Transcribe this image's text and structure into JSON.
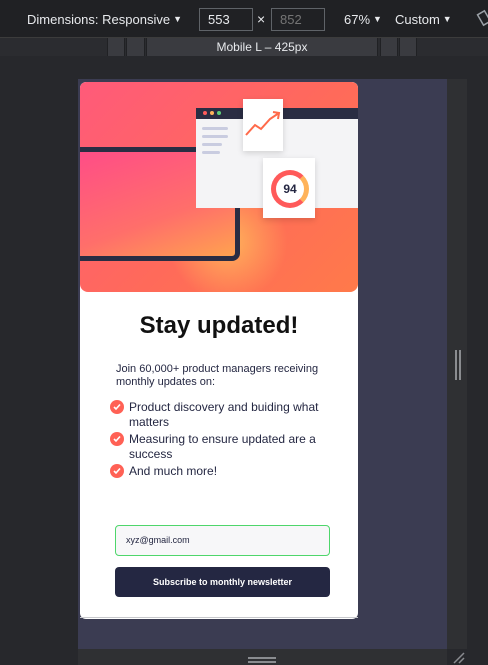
{
  "devtools": {
    "dimensions_label": "Dimensions: Responsive",
    "width_value": "553",
    "height_placeholder": "852",
    "times": "×",
    "zoom": "67%",
    "throttle": "Custom",
    "media_label": "Mobile L – 425px"
  },
  "newsletter": {
    "title": "Stay updated!",
    "intro": "Join 60,000+ product managers receiving monthly updates on:",
    "items": [
      "Product discovery and buiding what matters",
      "Measuring to ensure updated are a success",
      "And much more!"
    ],
    "score": "94",
    "email_value": "xyz@gmail.com",
    "button_label": "Subscribe to monthly newsletter"
  },
  "colors": {
    "accent": "#ff6155",
    "navy": "#242742",
    "valid_border": "#4ed66b"
  }
}
